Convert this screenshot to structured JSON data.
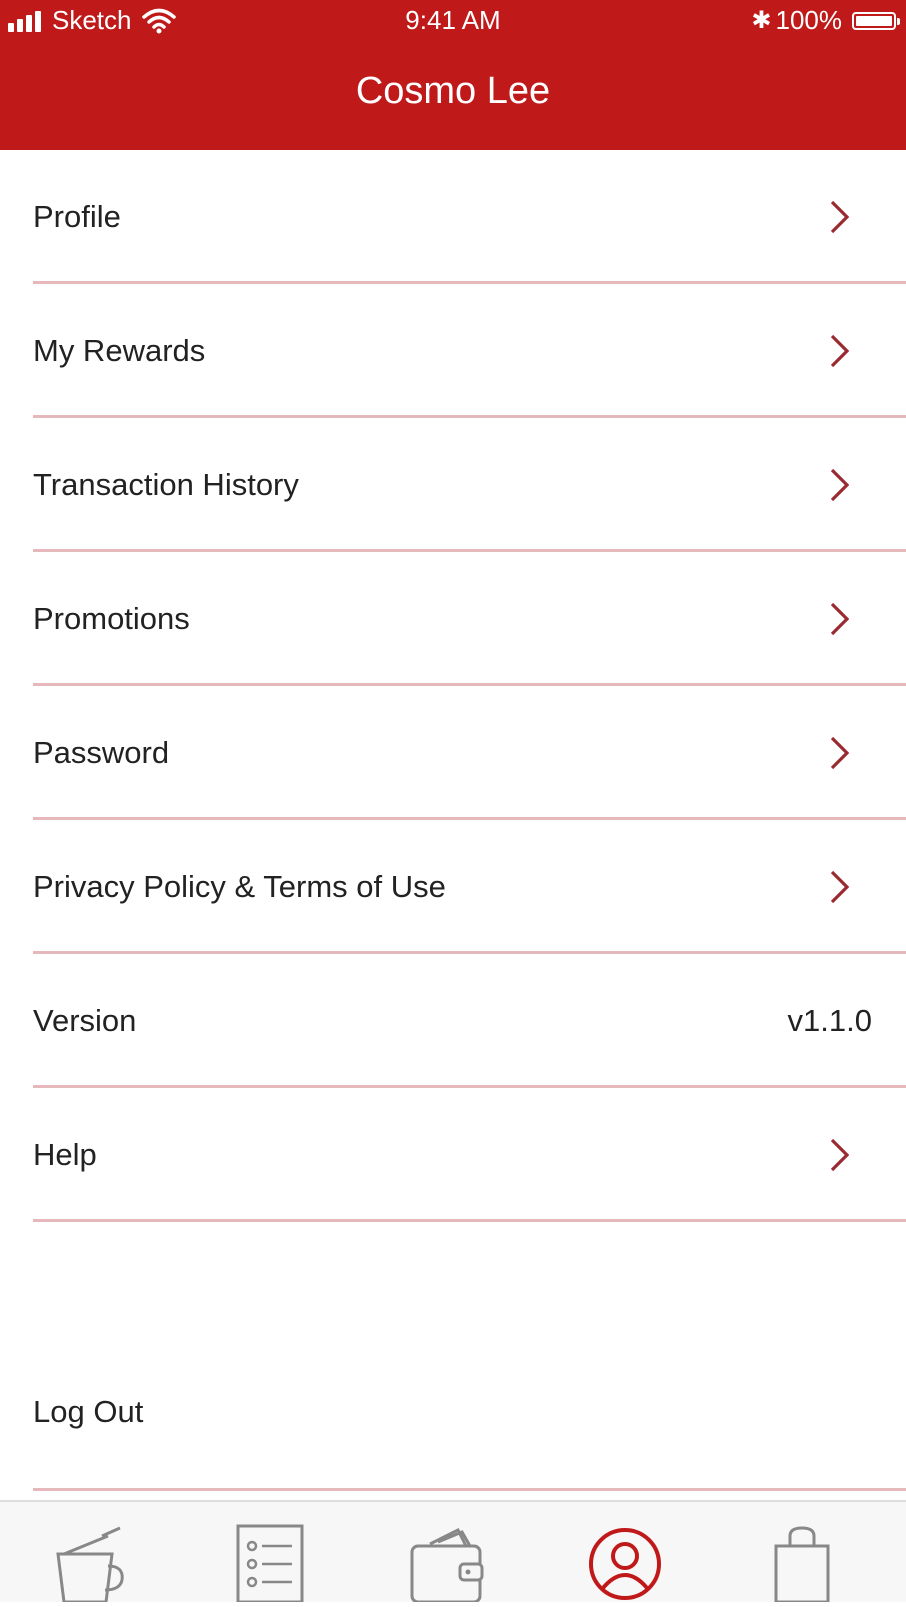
{
  "status_bar": {
    "carrier": "Sketch",
    "time": "9:41 AM",
    "battery": "100%"
  },
  "header": {
    "title": "Cosmo Lee"
  },
  "menu": {
    "items": [
      {
        "label": "Profile"
      },
      {
        "label": "My Rewards"
      },
      {
        "label": "Transaction History"
      },
      {
        "label": "Promotions"
      },
      {
        "label": "Password"
      },
      {
        "label": "Privacy Policy & Terms of Use"
      },
      {
        "label": "Version",
        "value": "v1.1.0"
      },
      {
        "label": "Help"
      }
    ],
    "logout_label": "Log Out"
  },
  "tab_bar": {
    "tabs": [
      {
        "icon": "coffee-cup-icon"
      },
      {
        "icon": "menu-list-icon"
      },
      {
        "icon": "wallet-icon"
      },
      {
        "icon": "account-icon",
        "active": true
      },
      {
        "icon": "shopping-bag-icon"
      }
    ]
  },
  "colors": {
    "brand": "#c0191a",
    "divider": "#e5b8bb",
    "chevron": "#9b2a30",
    "tab_icon": "#888888"
  }
}
